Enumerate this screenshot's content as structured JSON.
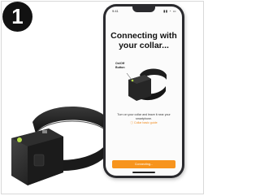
{
  "step": {
    "number": "1"
  },
  "phone": {
    "status_time": "9:41",
    "status_icons": "▮▮ ◔ ▭",
    "title": "Connecting with your collar...",
    "onoff_label": "On/Off Button",
    "instruction": "Turn on your collar and leave it near your smartphone.",
    "guide_link": "Collar basic guide",
    "connect_button": "Connecting..."
  },
  "colors": {
    "accent": "#f7941d",
    "badge": "#121212",
    "collar": "#1c1c1c"
  },
  "icons": {
    "guide": "info-circle-icon"
  }
}
